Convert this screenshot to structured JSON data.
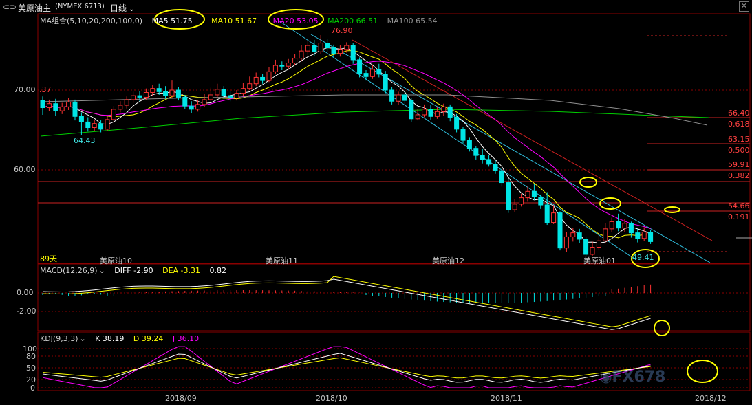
{
  "header": {
    "symbol_label": "美原油主",
    "contract_code": "(NYMEX 6713)",
    "period": "日线"
  },
  "price_panel": {
    "ma_title": "MA组合(5,10,20,200,100,0)",
    "ma5": "MA5 51.75",
    "ma10": "MA10 51.67",
    "ma20": "MA20 53.05",
    "ma200": "MA200 66.51",
    "ma100": "MA100 65.54",
    "high_label": "76.90",
    "low_label_left": "64.43",
    "low_label_right": "49.41",
    "level_70": "70.00",
    "level_60": "60.00",
    "left_value_fragment": ".37",
    "days_label": "89天",
    "contract_markers": [
      "美原油10",
      "美原油11",
      "美原油12",
      "美原油01"
    ]
  },
  "fib_levels": [
    {
      "price": "66.40",
      "ratio": "0.618"
    },
    {
      "price": "63.15",
      "ratio": "0.500"
    },
    {
      "price": "59.91",
      "ratio": "0.382"
    },
    {
      "price": "54.66",
      "ratio": "0.191"
    }
  ],
  "macd_panel": {
    "title": "MACD(12,26,9)",
    "diff": "DIFF -2.90",
    "dea": "DEA -3.31",
    "macd": "0.82",
    "y_labels": [
      "0.00",
      "-2.00"
    ]
  },
  "kdj_panel": {
    "title": "KDJ(9,3,3)",
    "k": "K 38.19",
    "d": "D 39.24",
    "j": "J 36.10",
    "y_labels": [
      "100",
      "80",
      "50",
      "20",
      "0"
    ]
  },
  "x_axis": {
    "labels": [
      "2018/09",
      "2018/10",
      "2018/11",
      "2018/12"
    ]
  },
  "watermark": "FX678",
  "colors": {
    "up": "#ff3232",
    "down": "#00e6e6",
    "ma5": "#ffffff",
    "ma10": "#ffff00",
    "ma20": "#ff00ff",
    "ma200": "#00d000",
    "ma100": "#909090",
    "highlight": "#ffff00",
    "grid": "#8b0000"
  },
  "chart_data": {
    "type": "candlestick",
    "price_range": [
      45.5,
      80.5
    ],
    "key_points": {
      "high": 76.9,
      "low_left": 64.43,
      "low_right": 49.41
    },
    "fib_retracement": [
      {
        "ratio": 0.618,
        "price": 66.4
      },
      {
        "ratio": 0.5,
        "price": 63.15
      },
      {
        "ratio": 0.382,
        "price": 59.91
      },
      {
        "ratio": 0.191,
        "price": 54.66
      }
    ],
    "candles_approx": [
      [
        68.7,
        67.8,
        69.2,
        66.9
      ],
      [
        67.8,
        68.3,
        68.8,
        67.4
      ],
      [
        68.3,
        67.4,
        68.9,
        66.8
      ],
      [
        67.4,
        67.9,
        68.4,
        67.0
      ],
      [
        67.9,
        68.5,
        69.0,
        67.5
      ],
      [
        68.5,
        66.7,
        68.8,
        66.2
      ],
      [
        66.7,
        66.0,
        67.2,
        64.4
      ],
      [
        66.0,
        65.3,
        66.6,
        64.8
      ],
      [
        65.3,
        65.8,
        66.3,
        64.9
      ],
      [
        65.8,
        65.1,
        66.2,
        64.7
      ],
      [
        65.1,
        66.3,
        66.7,
        64.9
      ],
      [
        66.3,
        67.6,
        68.0,
        66.0
      ],
      [
        67.6,
        68.1,
        68.6,
        67.2
      ],
      [
        68.1,
        68.8,
        69.2,
        67.7
      ],
      [
        68.8,
        69.3,
        69.8,
        68.4
      ],
      [
        69.3,
        69.1,
        69.9,
        68.6
      ],
      [
        69.1,
        69.7,
        70.2,
        68.8
      ],
      [
        69.7,
        70.2,
        70.6,
        69.3
      ],
      [
        70.2,
        69.8,
        70.8,
        69.4
      ],
      [
        69.8,
        69.3,
        70.5,
        68.9
      ],
      [
        69.3,
        70.0,
        71.2,
        69.0
      ],
      [
        70.0,
        69.1,
        70.4,
        68.7
      ],
      [
        69.1,
        68.0,
        69.4,
        67.6
      ],
      [
        68.0,
        67.6,
        68.6,
        67.1
      ],
      [
        67.6,
        68.2,
        68.7,
        67.3
      ],
      [
        68.2,
        68.8,
        69.5,
        67.9
      ],
      [
        68.8,
        69.4,
        70.3,
        68.5
      ],
      [
        69.4,
        70.1,
        70.8,
        69.0
      ],
      [
        70.1,
        69.3,
        70.5,
        68.9
      ],
      [
        69.3,
        69.0,
        69.9,
        68.6
      ],
      [
        69.0,
        69.6,
        70.0,
        68.7
      ],
      [
        69.6,
        70.2,
        70.9,
        69.3
      ],
      [
        70.2,
        70.8,
        71.7,
        70.0
      ],
      [
        70.8,
        71.6,
        72.2,
        70.5
      ],
      [
        71.6,
        71.2,
        72.0,
        70.8
      ],
      [
        71.2,
        72.3,
        72.9,
        71.0
      ],
      [
        72.3,
        73.1,
        73.8,
        72.0
      ],
      [
        73.1,
        73.0,
        73.6,
        72.5
      ],
      [
        73.0,
        73.4,
        73.9,
        72.6
      ],
      [
        73.4,
        74.0,
        74.5,
        73.1
      ],
      [
        74.0,
        74.9,
        75.6,
        73.6
      ],
      [
        74.9,
        75.6,
        76.2,
        74.4
      ],
      [
        75.6,
        74.8,
        76.3,
        74.3
      ],
      [
        74.8,
        75.9,
        76.9,
        74.5
      ],
      [
        75.9,
        75.3,
        76.4,
        74.8
      ],
      [
        75.3,
        74.6,
        75.7,
        74.0
      ],
      [
        74.6,
        75.1,
        75.6,
        74.2
      ],
      [
        75.1,
        75.6,
        76.0,
        74.7
      ],
      [
        75.6,
        73.8,
        75.9,
        73.3
      ],
      [
        73.8,
        72.1,
        74.1,
        71.6
      ],
      [
        72.1,
        71.7,
        72.5,
        71.2
      ],
      [
        71.7,
        72.6,
        73.1,
        71.4
      ],
      [
        72.6,
        72.0,
        73.3,
        71.6
      ],
      [
        72.0,
        70.0,
        72.4,
        69.6
      ],
      [
        70.0,
        68.6,
        70.4,
        68.2
      ],
      [
        68.6,
        69.4,
        69.8,
        68.1
      ],
      [
        69.4,
        68.7,
        70.0,
        68.3
      ],
      [
        68.7,
        66.4,
        69.0,
        66.0
      ],
      [
        66.4,
        66.9,
        67.6,
        66.2
      ],
      [
        66.9,
        67.6,
        68.2,
        66.6
      ],
      [
        67.6,
        66.7,
        68.1,
        66.3
      ],
      [
        66.7,
        67.3,
        67.9,
        66.4
      ],
      [
        67.3,
        67.9,
        68.3,
        66.8
      ],
      [
        67.9,
        66.6,
        68.2,
        66.1
      ],
      [
        66.6,
        65.1,
        67.0,
        64.7
      ],
      [
        65.1,
        63.7,
        65.4,
        63.3
      ],
      [
        63.7,
        62.7,
        64.1,
        62.3
      ],
      [
        62.7,
        61.8,
        63.0,
        61.3
      ],
      [
        61.8,
        61.3,
        62.6,
        60.8
      ],
      [
        61.3,
        60.7,
        61.9,
        60.4
      ],
      [
        60.7,
        59.9,
        61.2,
        59.5
      ],
      [
        59.9,
        58.4,
        60.3,
        57.9
      ],
      [
        58.4,
        55.0,
        58.8,
        54.6
      ],
      [
        55.0,
        55.7,
        56.3,
        54.7
      ],
      [
        55.7,
        56.5,
        57.0,
        55.4
      ],
      [
        56.5,
        57.3,
        57.9,
        56.0
      ],
      [
        57.3,
        56.6,
        58.2,
        56.2
      ],
      [
        56.6,
        55.6,
        56.9,
        55.1
      ],
      [
        55.6,
        53.4,
        57.2,
        53.1
      ],
      [
        53.4,
        54.6,
        55.6,
        53.2
      ],
      [
        54.6,
        50.2,
        54.8,
        49.9
      ],
      [
        50.2,
        51.6,
        52.2,
        49.7
      ],
      [
        51.6,
        52.1,
        52.7,
        51.0
      ],
      [
        52.1,
        51.3,
        52.6,
        50.8
      ],
      [
        51.3,
        49.4,
        51.6,
        49.1
      ],
      [
        49.4,
        50.3,
        51.0,
        49.2
      ],
      [
        50.3,
        51.1,
        52.2,
        49.9
      ],
      [
        51.1,
        52.6,
        53.3,
        50.8
      ],
      [
        52.6,
        53.5,
        54.0,
        52.2
      ],
      [
        53.5,
        52.7,
        54.5,
        52.3
      ],
      [
        52.7,
        53.3,
        53.8,
        52.2
      ],
      [
        53.3,
        52.1,
        53.5,
        51.5
      ],
      [
        52.1,
        51.4,
        52.6,
        50.9
      ],
      [
        51.4,
        52.2,
        52.8,
        51.1
      ],
      [
        52.2,
        51.0,
        52.5,
        50.7
      ]
    ]
  }
}
